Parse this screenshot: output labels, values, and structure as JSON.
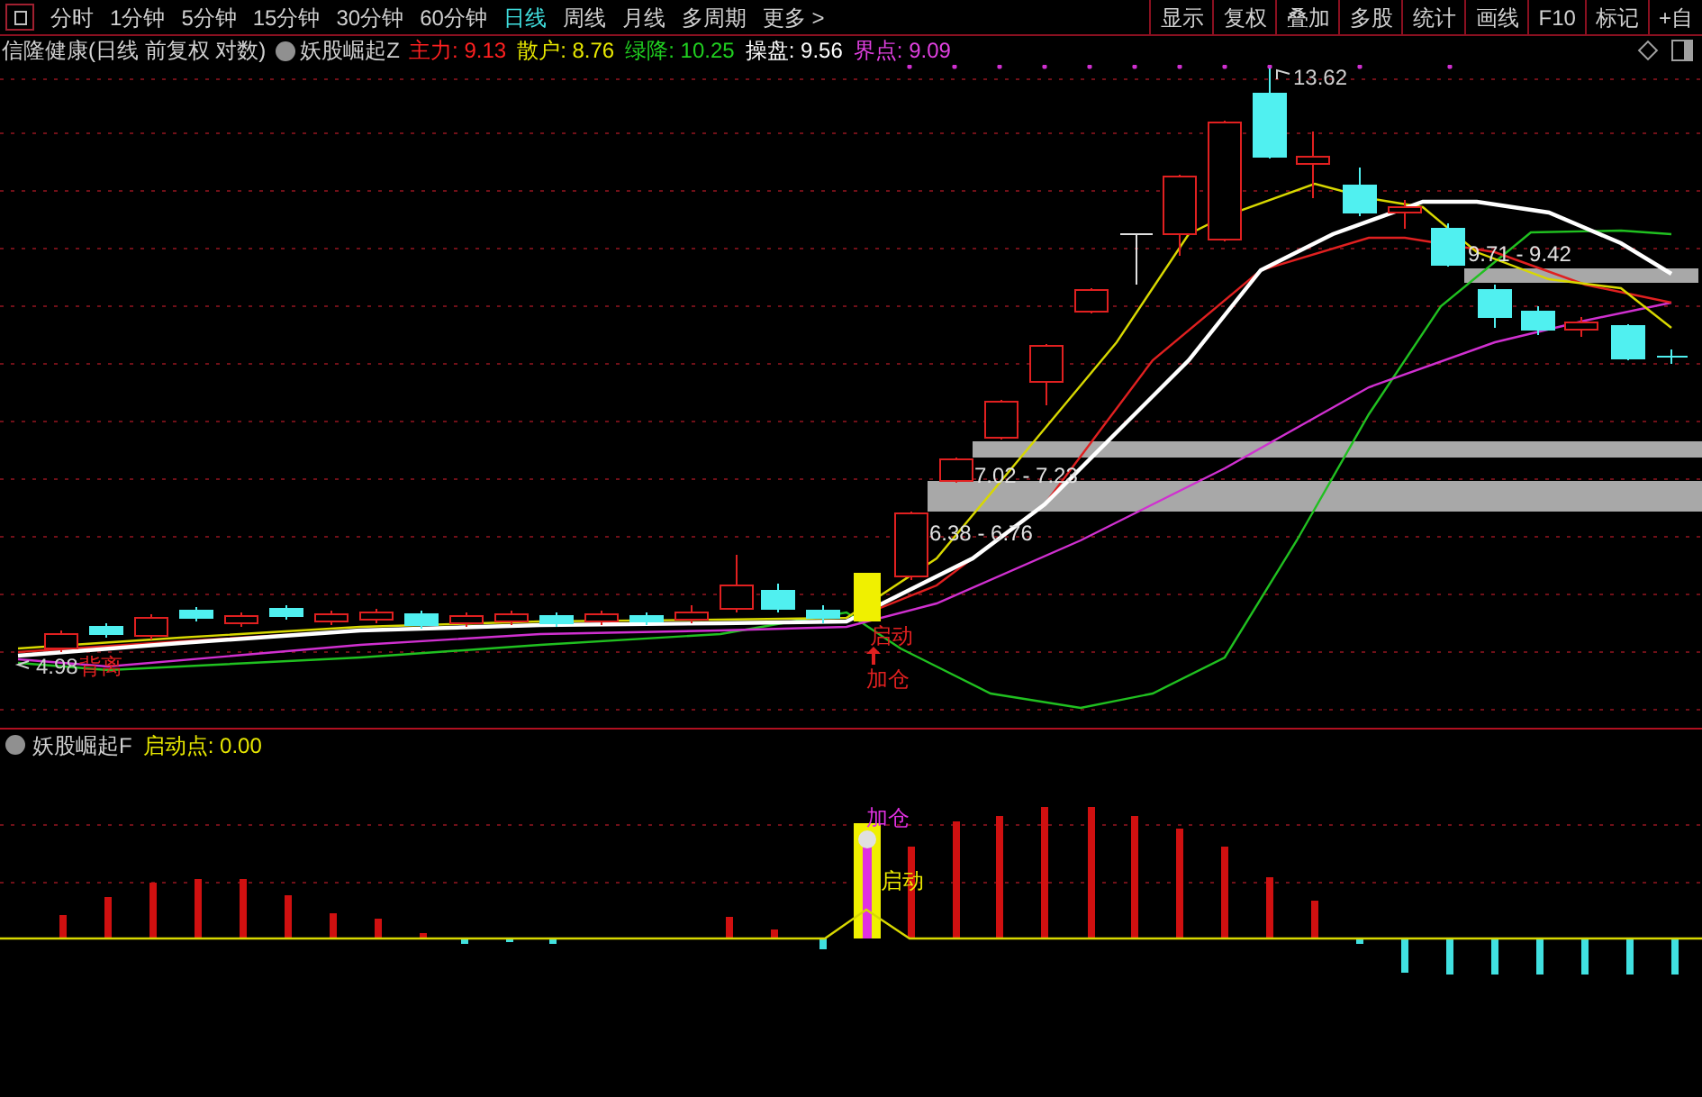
{
  "period_tabs": [
    {
      "label": "分时",
      "selected": false
    },
    {
      "label": "1分钟",
      "selected": false
    },
    {
      "label": "5分钟",
      "selected": false
    },
    {
      "label": "15分钟",
      "selected": false
    },
    {
      "label": "30分钟",
      "selected": false
    },
    {
      "label": "60分钟",
      "selected": false
    },
    {
      "label": "日线",
      "selected": true
    },
    {
      "label": "周线",
      "selected": false
    },
    {
      "label": "月线",
      "selected": false
    },
    {
      "label": "多周期",
      "selected": false
    },
    {
      "label": "更多 >",
      "selected": false
    }
  ],
  "toolbar_buttons": [
    "显示",
    "复权",
    "叠加",
    "多股",
    "统计",
    "画线",
    "F10",
    "标记",
    "+自"
  ],
  "main_chart": {
    "stock": "信隆健康(日线 前复权 对数)",
    "indicator": "妖股崛起Z",
    "values": [
      {
        "label": "主力:",
        "value": "9.13",
        "color": "#ff2020"
      },
      {
        "label": "散户:",
        "value": "8.76",
        "color": "#e8e800"
      },
      {
        "label": "绿降:",
        "value": "10.25",
        "color": "#20d020"
      },
      {
        "label": "操盘:",
        "value": "9.56",
        "color": "#ffffff"
      },
      {
        "label": "界点:",
        "value": "9.09",
        "color": "#e040e0"
      }
    ],
    "high_label": "13.62",
    "low_label": "4.98",
    "divergence_label": "背离",
    "start_label": "启动",
    "add_label": "加仓",
    "zones": [
      "9.71 - 9.42",
      "7.02 - 7.23",
      "6.38 - 6.76"
    ]
  },
  "sub_chart": {
    "indicator": "妖股崛起F",
    "reading_label": "启动点:",
    "reading_value": "0.00",
    "add_label": "加仓",
    "start_label": "启动"
  }
}
